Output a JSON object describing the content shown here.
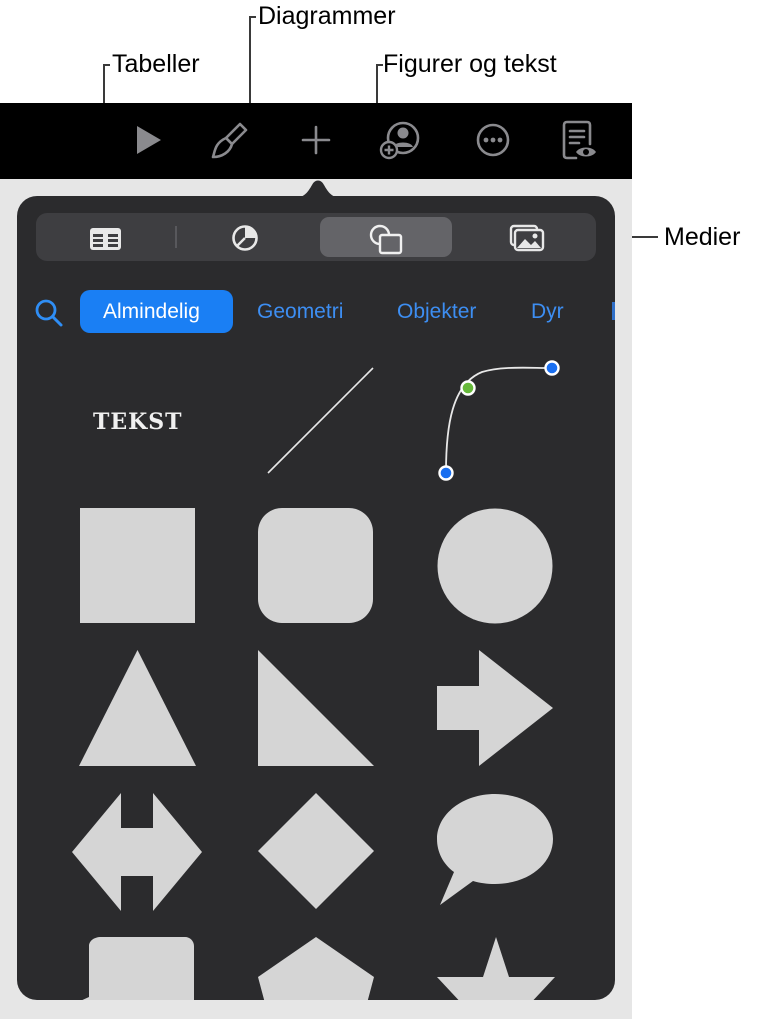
{
  "callouts": {
    "tables": "Tabeller",
    "charts": "Diagrammer",
    "shapes": "Figurer og tekst",
    "media": "Medier"
  },
  "toolbar": {
    "icons": [
      "play-icon",
      "paintbrush-icon",
      "plus-icon",
      "collaborate-icon",
      "more-icon",
      "reader-icon"
    ]
  },
  "segmented_control": {
    "items": [
      "table-icon",
      "chart-icon",
      "shapes-icon",
      "media-icon"
    ],
    "selected": "shapes-icon"
  },
  "categories": {
    "items": [
      "Almindelig",
      "Geometri",
      "Objekter",
      "Dyr"
    ],
    "selected": "Almindelig"
  },
  "shapes": {
    "text_item": "TEKST",
    "items": [
      "text",
      "line",
      "curve",
      "square",
      "rounded-square",
      "circle",
      "triangle",
      "right-triangle",
      "arrow-right",
      "double-arrow",
      "diamond",
      "speech-bubble",
      "callout-box",
      "pentagon",
      "star"
    ]
  },
  "colors": {
    "popover": "#2b2b2d",
    "accent": "#1a7ff4",
    "shape_fill": "#d5d5d5",
    "curve_handle_end": "#1a6ff0",
    "curve_handle_control": "#66b93a"
  }
}
